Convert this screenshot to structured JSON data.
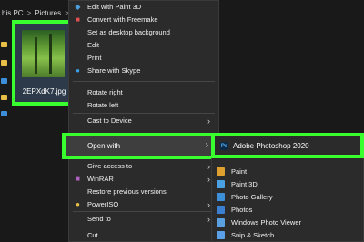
{
  "breadcrumb": {
    "this_pc": "his PC",
    "pictures": "Pictures",
    "separator": ">"
  },
  "file": {
    "name": "2EPXdK7.jpg"
  },
  "context_menu": {
    "items": [
      {
        "label": "Edit with Paint 3D",
        "icon": "paint3d-icon"
      },
      {
        "label": "Convert with Freemake",
        "icon": "freemake-icon"
      },
      {
        "label": "Set as desktop background",
        "icon": ""
      },
      {
        "label": "Edit",
        "icon": ""
      },
      {
        "label": "Print",
        "icon": ""
      },
      {
        "label": "Share with Skype",
        "icon": "skype-icon"
      },
      {
        "label": "Rotate right",
        "icon": ""
      },
      {
        "label": "Rotate left",
        "icon": ""
      },
      {
        "label": "Cast to Device",
        "icon": "",
        "submenu": true
      },
      {
        "label": "Open with",
        "icon": "",
        "submenu": true
      },
      {
        "label": "Give access to",
        "icon": "",
        "submenu": true
      },
      {
        "label": "WinRAR",
        "icon": "winrar-icon",
        "submenu": true
      },
      {
        "label": "Restore previous versions",
        "icon": ""
      },
      {
        "label": "PowerISO",
        "icon": "poweriso-icon",
        "submenu": true
      },
      {
        "label": "Send to",
        "icon": "",
        "submenu": true
      },
      {
        "label": "Cut",
        "icon": ""
      }
    ]
  },
  "open_with_submenu": {
    "highlighted": {
      "label": "Adobe Photoshop 2020",
      "icon": "photoshop-icon"
    },
    "items": [
      {
        "label": "Paint",
        "icon": "paint-icon",
        "color": "#e0a030"
      },
      {
        "label": "Paint 3D",
        "icon": "paint3d-icon",
        "color": "#4aa0e0"
      },
      {
        "label": "Photo Gallery",
        "icon": "photo-gallery-icon",
        "color": "#3c8fd8"
      },
      {
        "label": "Photos",
        "icon": "photos-icon",
        "color": "#3a7fd0"
      },
      {
        "label": "Windows Photo Viewer",
        "icon": "photo-viewer-icon",
        "color": "#5a9fe0"
      },
      {
        "label": "Snip & Sketch",
        "icon": "snip-sketch-icon",
        "color": "#5aa0e8"
      }
    ]
  },
  "colors": {
    "highlight": "#39ff2e",
    "menu_bg": "#2b2b2b",
    "background": "#191919"
  }
}
